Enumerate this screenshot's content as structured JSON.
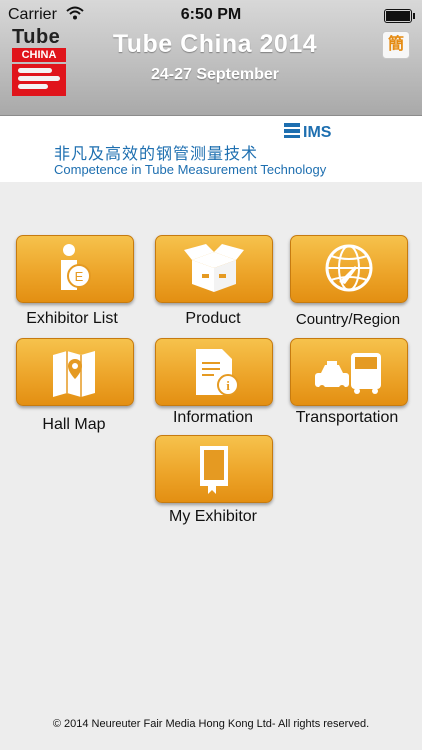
{
  "status": {
    "carrier": "Carrier",
    "time": "6:50 PM"
  },
  "header": {
    "logo_word": "Tube",
    "logo_china": "CHINA",
    "title": "Tube China 2014",
    "dates": "24-27 September",
    "language_button": "簡"
  },
  "banner": {
    "chinese_text": "非凡及高效的钢管测量技术",
    "english_text": "Competence in Tube Measurement Technology",
    "brand": "IMS"
  },
  "menu": [
    {
      "label": "Exhibitor List",
      "icon": "exhibitor-person-icon"
    },
    {
      "label": "Product",
      "icon": "product-box-icon"
    },
    {
      "label": "Country/Region",
      "icon": "globe-plane-icon"
    },
    {
      "label": "Hall Map",
      "icon": "map-pin-icon"
    },
    {
      "label": "Information",
      "icon": "document-info-icon"
    },
    {
      "label": "Transportation",
      "icon": "taxi-bus-icon"
    },
    {
      "label": "My Exhibitor",
      "icon": "bookmark-book-icon"
    }
  ],
  "footer": "© 2014 Neureuter Fair Media Hong Kong Ltd- All rights reserved.",
  "colors": {
    "tile": "#eda52a",
    "tile_border": "#c67b10",
    "banner_text": "#1e6fb0",
    "logo_red": "#e0141b"
  }
}
